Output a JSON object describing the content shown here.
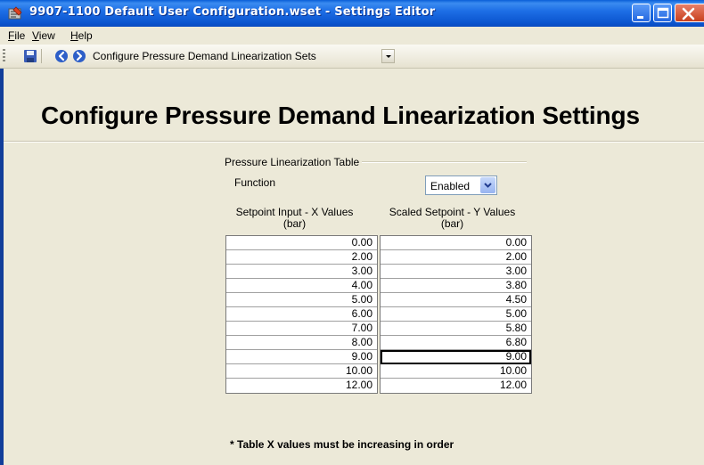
{
  "window": {
    "title": "9907-1100 Default User Configuration.wset - Settings Editor",
    "app_icon": "settings-editor-app-icon",
    "controls": [
      "minimize-icon",
      "maximize-icon",
      "close-icon"
    ]
  },
  "menu": {
    "items": [
      {
        "accel": "F",
        "rest": "ile"
      },
      {
        "accel": "V",
        "rest": "iew"
      },
      {
        "accel": "H",
        "rest": "elp"
      }
    ]
  },
  "toolbar": {
    "icons": [
      "save-icon",
      "back-icon",
      "forward-icon"
    ],
    "page_select": "Configure Pressure Demand Linearization Sets"
  },
  "page": {
    "heading": "Configure Pressure Demand Linearization Settings",
    "group_title": "Pressure Linearization Table",
    "function_label": "Function",
    "function_value": "Enabled",
    "x_header_1": "Setpoint Input - X Values",
    "x_header_2": "(bar)",
    "y_header_1": "Scaled Setpoint - Y Values",
    "y_header_2": "(bar)",
    "x_values": [
      "0.00",
      "2.00",
      "3.00",
      "4.00",
      "5.00",
      "6.00",
      "7.00",
      "8.00",
      "9.00",
      "10.00",
      "12.00"
    ],
    "y_values": [
      "0.00",
      "2.00",
      "3.00",
      "3.80",
      "4.50",
      "5.00",
      "5.80",
      "6.80",
      "9.00",
      "10.00",
      "12.00"
    ],
    "footnote": "* Table X values must be increasing in order"
  },
  "colors": {
    "titlebar": "#0A5FD8",
    "face": "#ECE9D8",
    "close_button": "#C8401E"
  }
}
